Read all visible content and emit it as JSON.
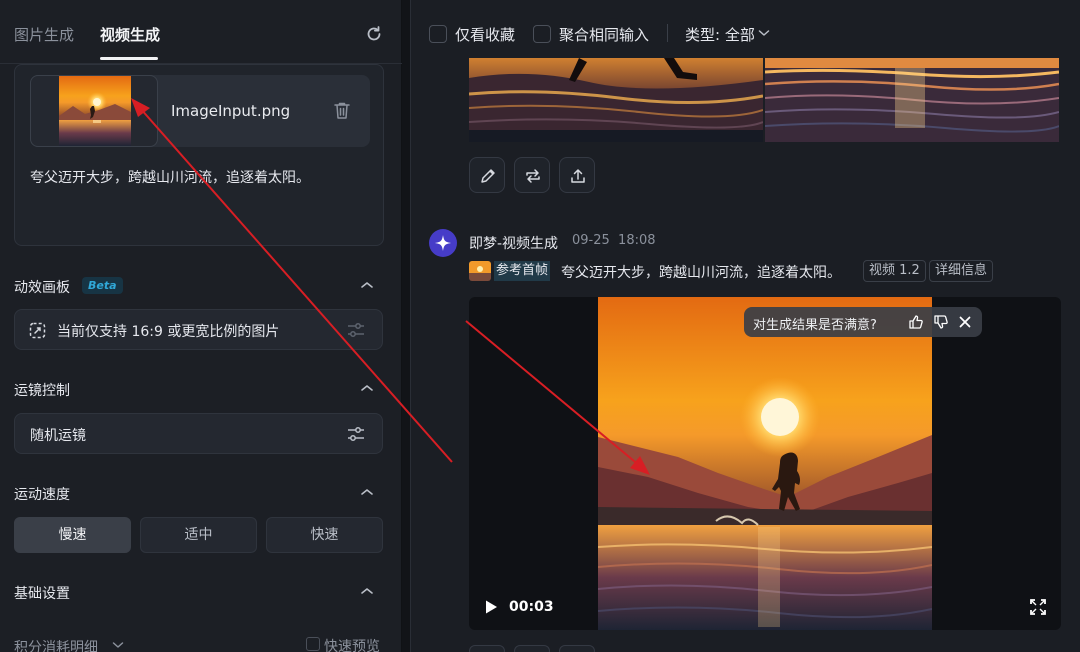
{
  "left_panel": {
    "tabs": [
      {
        "label": "图片生成",
        "active": false
      },
      {
        "label": "视频生成",
        "active": true
      }
    ],
    "upload": {
      "file_name": "ImageInput.png",
      "prompt": "夸父迈开大步，跨越山川河流，追逐着太阳。"
    },
    "effect_canvas": {
      "title": "动效画板",
      "badge": "Beta",
      "notice": "当前仅支持 16:9 或更宽比例的图片"
    },
    "camera_control": {
      "title": "运镜控制",
      "value": "随机运镜"
    },
    "motion_speed": {
      "title": "运动速度",
      "options": [
        "慢速",
        "适中",
        "快速"
      ],
      "selected": "慢速"
    },
    "basic_settings": {
      "title": "基础设置"
    },
    "footer": {
      "credits_label": "积分消耗明细",
      "fast_preview_label": "快速预览"
    }
  },
  "right_panel": {
    "filters": {
      "favorites_only": "仅看收藏",
      "merge_same_input": "聚合相同输入",
      "type_filter": "类型: 全部"
    },
    "generation": {
      "title": "即梦-视频生成",
      "date": "09-25",
      "time": "18:08",
      "ref_label": "参考首帧",
      "prompt": "夸父迈开大步，跨越山川河流，追逐着太阳。",
      "model_tag": "视频 1.2",
      "details_tag": "详细信息"
    },
    "video": {
      "current_time": "00:03"
    },
    "feedback": {
      "question": "对生成结果是否满意?"
    }
  },
  "colors": {
    "accent_beta": "#30a8d8",
    "avatar": "#463cc8",
    "annotation_arrow": "#d81e24"
  }
}
